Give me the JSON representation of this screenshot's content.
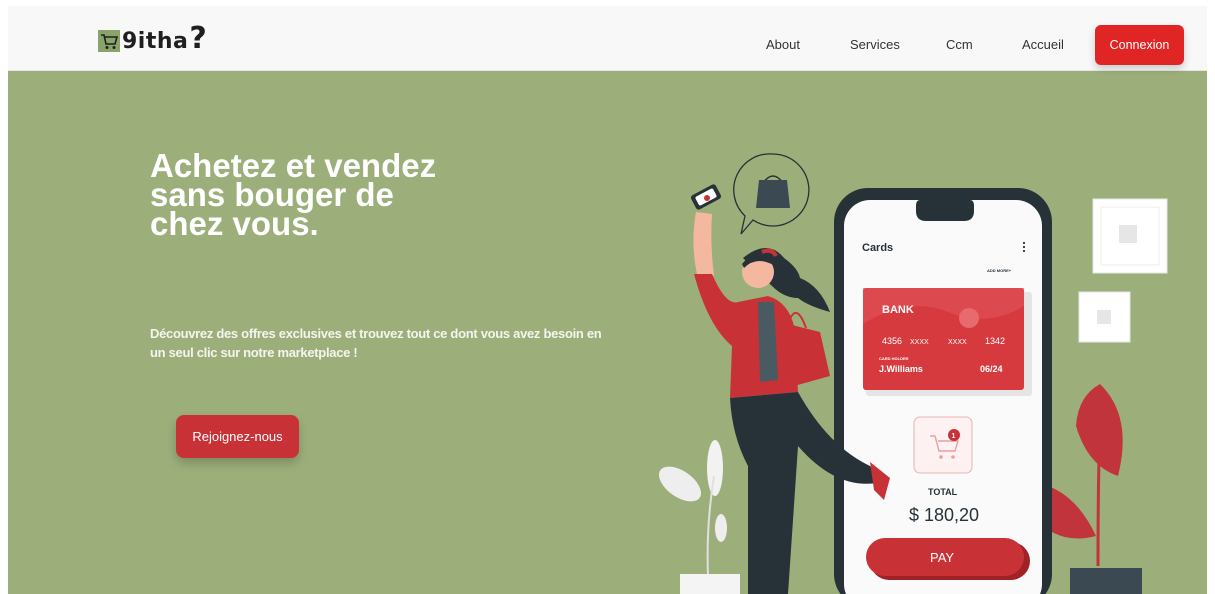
{
  "brand": {
    "logo_text": "9itha",
    "logo_mark": "?"
  },
  "nav": {
    "links": [
      "About",
      "Services",
      "Ccm",
      "Accueil"
    ],
    "login_label": "Connexion"
  },
  "hero": {
    "title": "Achetez et vendez sans bouger de chez vous.",
    "subtitle": "Découvrez des offres exclusives et trouvez tout ce dont vous avez besoin en un seul clic sur notre marketplace !",
    "cta_label": "Rejoignez-nous"
  },
  "phone": {
    "title": "Cards",
    "add_more": "ADD MORE+",
    "card": {
      "bank": "BANK",
      "number": [
        "4356",
        "XXXX",
        "XXXX",
        "1342"
      ],
      "holder_label": "CARD HOLDER",
      "holder": "J.Williams",
      "expiry": "06/24"
    },
    "cart_badge": "1",
    "total_label": "TOTAL",
    "total_value": "$ 180,20",
    "pay_label": "PAY"
  },
  "colors": {
    "hero_bg": "#9caf7b",
    "accent_red": "#e02525",
    "cta_red": "#c83237",
    "card_red": "#d63a3e",
    "phone_dark": "#263238"
  },
  "icons": [
    "cart-logo-icon",
    "shopping-bag-icon",
    "cart-icon",
    "more-vertical-icon"
  ]
}
